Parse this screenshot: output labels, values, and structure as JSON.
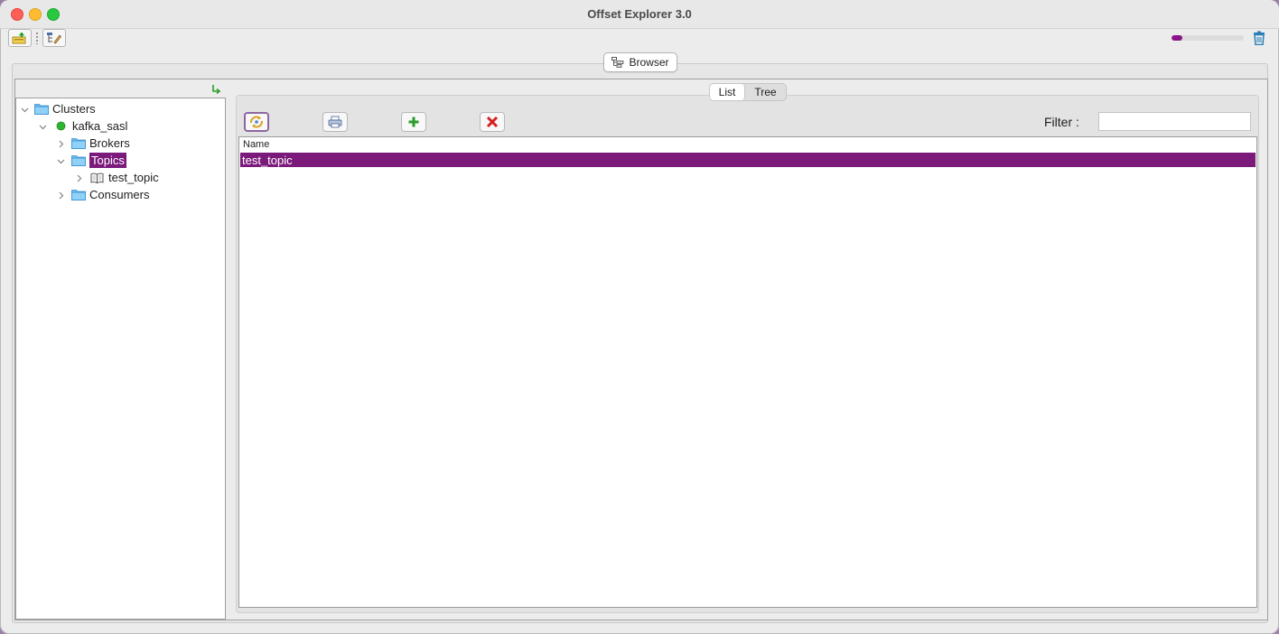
{
  "window": {
    "title": "Offset Explorer  3.0"
  },
  "toolbar": {
    "left_buttons": [
      {
        "icon": "add-connection-icon"
      },
      {
        "icon": "edit-tree-icon"
      }
    ],
    "progress_fraction": 0.15,
    "progress_color": "#8a158a",
    "trash_icon": "trash-icon"
  },
  "browser_tab": {
    "label": "Browser",
    "icon": "browser-tree-icon"
  },
  "tree": {
    "root": "Clusters",
    "cluster": "kafka_sasl",
    "cluster_status_color": "#2fb52f",
    "nodes": [
      "Brokers",
      "Topics",
      "Consumers"
    ],
    "topic_child": "test_topic",
    "selected": "Topics"
  },
  "view_toggle": {
    "options": [
      "List",
      "Tree"
    ],
    "selected": "List"
  },
  "actions": [
    {
      "icon": "refresh-icon"
    },
    {
      "icon": "print-icon"
    },
    {
      "icon": "add-icon"
    },
    {
      "icon": "delete-icon"
    }
  ],
  "filter": {
    "label": "Filter :",
    "value": ""
  },
  "table": {
    "columns": [
      "Name"
    ],
    "rows": [
      {
        "name": "test_topic",
        "selected": true
      }
    ]
  },
  "colors": {
    "selection": "#7b1a7b",
    "folder": "#6ec0f2"
  }
}
